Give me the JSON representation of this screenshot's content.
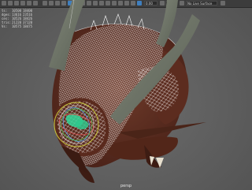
{
  "toolbar": {
    "field_1": "0.00",
    "field_2": "1.00",
    "field_3": "No Live Surface"
  },
  "hud": {
    "rows": [
      {
        "label": "ts:",
        "v1": "10500",
        "v2": "18400"
      },
      {
        "label": "dges:",
        "v1": "13616",
        "v2": "23516"
      },
      {
        "label": "ces:",
        "v1": "10526",
        "v2": "18426"
      },
      {
        "label": "tris:",
        "v1": "21220",
        "v2": "37120"
      },
      {
        "label": "Vs:",
        "v1": "10575",
        "v2": "18475"
      }
    ]
  },
  "viewport": {
    "camera": "persp"
  },
  "colors": {
    "viewport_bg": "#5f5f5f",
    "wireframe": "#ffffff",
    "manipulator_ring": "#c9c93a",
    "selection": "#33d89a"
  },
  "icons": [
    "select-icon",
    "lasso-icon",
    "paint-icon",
    "move-icon",
    "rotate-icon",
    "scale-icon",
    "camera-icon",
    "grid-icon",
    "wireframe-icon",
    "shaded-icon",
    "xray-icon"
  ]
}
